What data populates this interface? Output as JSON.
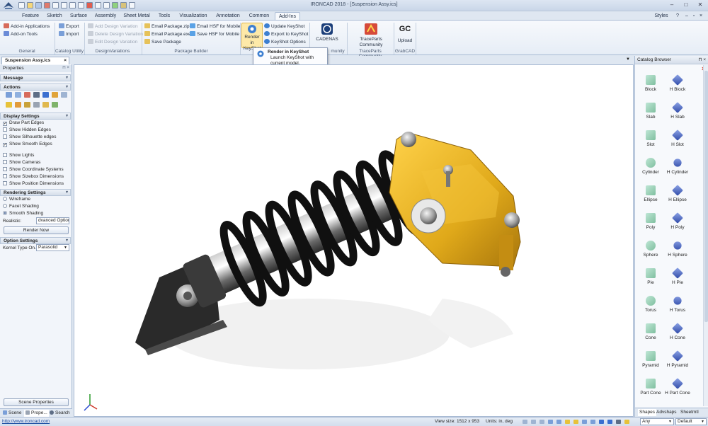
{
  "window": {
    "title": "IRONCAD 2018 - [Suspension Assy.ics]",
    "styles_label": "Styles"
  },
  "ribbon_tabs": [
    "Feature",
    "Sketch",
    "Surface",
    "Assembly",
    "Sheet Metal",
    "Tools",
    "Visualization",
    "Annotation",
    "Common",
    "Add-Ins"
  ],
  "ribbon": {
    "general": {
      "label": "General",
      "items": [
        "Add-in Applications",
        "Add-on Tools"
      ]
    },
    "catalog_utility": {
      "label": "Catalog Utility",
      "items": [
        "Export",
        "Import"
      ]
    },
    "design_variations": {
      "label": "DesignVariations",
      "items": [
        "Add Design Variation",
        "Delete Design Variation",
        "Edit Design Variation"
      ]
    },
    "package_builder": {
      "label": "Package Builder",
      "items": [
        "Email Package.zip",
        "Email Package.exe",
        "Save Package",
        "Email HSF for Mobile",
        "Save HSF for Mobile"
      ]
    },
    "keyshot": {
      "big_button": "Render in KeyShot",
      "items": [
        "Update KeyShot",
        "Export to KeyShot",
        "KeyShot Options"
      ]
    },
    "cadenas": {
      "label": "CADENAS",
      "group_suffix": "munity"
    },
    "traceparts": {
      "label": "TraceParts Community",
      "group": "TraceParts Community"
    },
    "grabcad": {
      "logo": "GC",
      "label": "Upload",
      "group": "GrabCAD"
    }
  },
  "tooltip": {
    "title": "Render in KeyShot",
    "description": "Launch KeyShot with current model."
  },
  "document_tab": "Suspension Assy.ics",
  "left_panel": {
    "title": "Properties",
    "sections": {
      "message": "Message",
      "actions": "Actions",
      "display": "Display Settings",
      "rendering": "Rendering Settings",
      "option": "Option Settings"
    },
    "display_options": [
      {
        "label": "Draw Part Edges",
        "checked": true
      },
      {
        "label": "Show Hidden Edges",
        "checked": false
      },
      {
        "label": "Show Silhouette edges",
        "checked": false
      },
      {
        "label": "Show Smooth Edges",
        "checked": true
      },
      {
        "label": "Show Lights",
        "checked": false
      },
      {
        "label": "Show Cameras",
        "checked": false
      },
      {
        "label": "Show Coordinate Systems",
        "checked": false
      },
      {
        "label": "Show Sizebox Dimensions",
        "checked": false
      },
      {
        "label": "Show Position Dimensions",
        "checked": false
      }
    ],
    "rendering_options": [
      {
        "label": "Wireframe",
        "selected": false
      },
      {
        "label": "Facet Shading",
        "selected": false
      },
      {
        "label": "Smooth Shading",
        "selected": true
      }
    ],
    "realistic_label": "Realistic:",
    "realistic_value": "dvanced Option",
    "render_now": "Render Now",
    "kernel_label": "Kernel Type On...",
    "kernel_value": "Parasolid",
    "scene_properties": "Scene Properties",
    "bottom_tabs": [
      "Scene",
      "Prope...",
      "Search"
    ]
  },
  "catalog": {
    "title": "Catalog Browser",
    "items": [
      [
        "Block",
        "H Block"
      ],
      [
        "Slab",
        "H Slab"
      ],
      [
        "Slot",
        "H Slot"
      ],
      [
        "Cylinder",
        "H Cylinder"
      ],
      [
        "Ellipse",
        "H Ellipse"
      ],
      [
        "Poly",
        "H Poly"
      ],
      [
        "Sphere",
        "H Sphere"
      ],
      [
        "Pie",
        "H Pie"
      ],
      [
        "Torus",
        "H Torus"
      ],
      [
        "Cone",
        "H Cone"
      ],
      [
        "Pyramid",
        "H Pyramid"
      ],
      [
        "Part Cone",
        "H Part Cone"
      ]
    ],
    "tabs": [
      "Shapes",
      "Advshaps",
      "Sheetmtl"
    ]
  },
  "status_bar": {
    "link": "http://www.ironcad.com",
    "view_size": "View size: 1512 x 953",
    "units": "Units: in, deg",
    "filter": "Any",
    "scheme": "Default"
  },
  "colors": {
    "accent": "#2b579a",
    "bracket": "#e8b820",
    "spring": "#151515",
    "ribbon_bg": "#f2f5fa"
  }
}
